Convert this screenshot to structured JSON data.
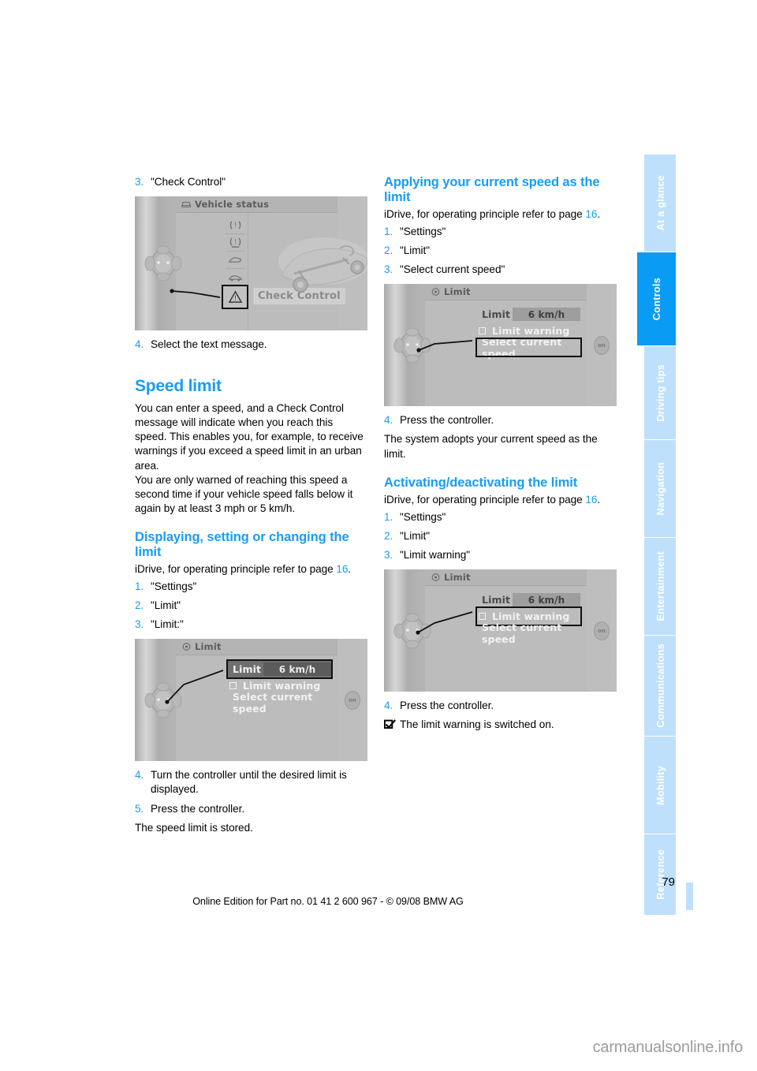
{
  "page": {
    "number": "79",
    "footer": "Online Edition for Part no. 01 41 2 600 967  - © 09/08 BMW AG",
    "watermark": "carmanualsonline.info",
    "accent_color": "#199cf4",
    "tab_active_color": "#0a9bf5",
    "tab_inactive_color": "#bfe0fa"
  },
  "sidebar": {
    "items": [
      {
        "label": "At a glance",
        "active": false
      },
      {
        "label": "Controls",
        "active": true
      },
      {
        "label": "Driving tips",
        "active": false
      },
      {
        "label": "Navigation",
        "active": false
      },
      {
        "label": "Entertainment",
        "active": false
      },
      {
        "label": "Communications",
        "active": false
      },
      {
        "label": "Mobility",
        "active": false
      },
      {
        "label": "Reference",
        "active": false
      }
    ]
  },
  "left_column": {
    "step3": {
      "num": "3.",
      "text": "\"Check Control\""
    },
    "shot_vehicle_status": {
      "title": "Vehicle status",
      "selected_label": "Check Control",
      "title_icon": "vehicle-icon",
      "menu_icons": [
        "tire-pressure-icon",
        "tire-pressure-alt-icon",
        "engine-hood-icon",
        "vehicle-side-icon",
        "warning-triangle-icon"
      ]
    },
    "step4": {
      "num": "4.",
      "text": "Select the text message."
    },
    "heading": "Speed limit",
    "intro_p1": "You can enter a speed, and a Check Control message will indicate when you reach this speed. This enables you, for example, to receive warnings if you exceed a speed limit in an urban area.",
    "intro_p2": "You are only warned of reaching this speed a second time if your vehicle speed falls below it again by at least 3 mph or 5 km/h.",
    "sub_heading": "Displaying, setting or changing the limit",
    "idrive_note_pre": "iDrive, for operating principle refer to page ",
    "idrive_note_page": "16",
    "idrive_note_post": ".",
    "steps": [
      {
        "num": "1.",
        "text": "\"Settings\""
      },
      {
        "num": "2.",
        "text": "\"Limit\""
      },
      {
        "num": "3.",
        "text": "\"Limit:\""
      }
    ],
    "shot_limit": {
      "title": "Limit",
      "title_icon": "gear-icon",
      "row_limit_label": "Limit",
      "row_limit_value": "6 km/h",
      "row_warning_label": "Limit warning",
      "row_select_label": "Select current speed",
      "highlighted_row": "Limit",
      "onoff_label": "on"
    },
    "steps_after": [
      {
        "num": "4.",
        "text": "Turn the controller until the desired limit is displayed."
      },
      {
        "num": "5.",
        "text": "Press the controller."
      }
    ],
    "closing": "The speed limit is stored."
  },
  "right_column": {
    "heading1": "Applying your current speed as the limit",
    "idrive_note_pre": "iDrive, for operating principle refer to page ",
    "idrive_note_page": "16",
    "idrive_note_post": ".",
    "steps1": [
      {
        "num": "1.",
        "text": "\"Settings\""
      },
      {
        "num": "2.",
        "text": "\"Limit\""
      },
      {
        "num": "3.",
        "text": "\"Select current speed\""
      }
    ],
    "shot1": {
      "title": "Limit",
      "title_icon": "gear-icon",
      "row_limit_label": "Limit",
      "row_limit_value": "6 km/h",
      "row_warning_label": "Limit warning",
      "row_select_label": "Select current speed",
      "highlighted_row": "Select current speed",
      "onoff_label": "on"
    },
    "step4a": {
      "num": "4.",
      "text": "Press the controller."
    },
    "result1": "The system adopts your current speed as the limit.",
    "heading2": "Activating/deactivating the limit",
    "idrive_note2_pre": "iDrive, for operating principle refer to page ",
    "idrive_note2_page": "16",
    "idrive_note2_post": ".",
    "steps2": [
      {
        "num": "1.",
        "text": "\"Settings\""
      },
      {
        "num": "2.",
        "text": "\"Limit\""
      },
      {
        "num": "3.",
        "text": "\"Limit warning\""
      }
    ],
    "shot2": {
      "title": "Limit",
      "title_icon": "gear-icon",
      "row_limit_label": "Limit",
      "row_limit_value": "6 km/h",
      "row_warning_label": "Limit warning",
      "row_select_label": "Select current speed",
      "highlighted_row": "Limit warning",
      "onoff_label": "on"
    },
    "step4b": {
      "num": "4.",
      "text": "Press the controller."
    },
    "note": "The limit warning is switched on."
  }
}
